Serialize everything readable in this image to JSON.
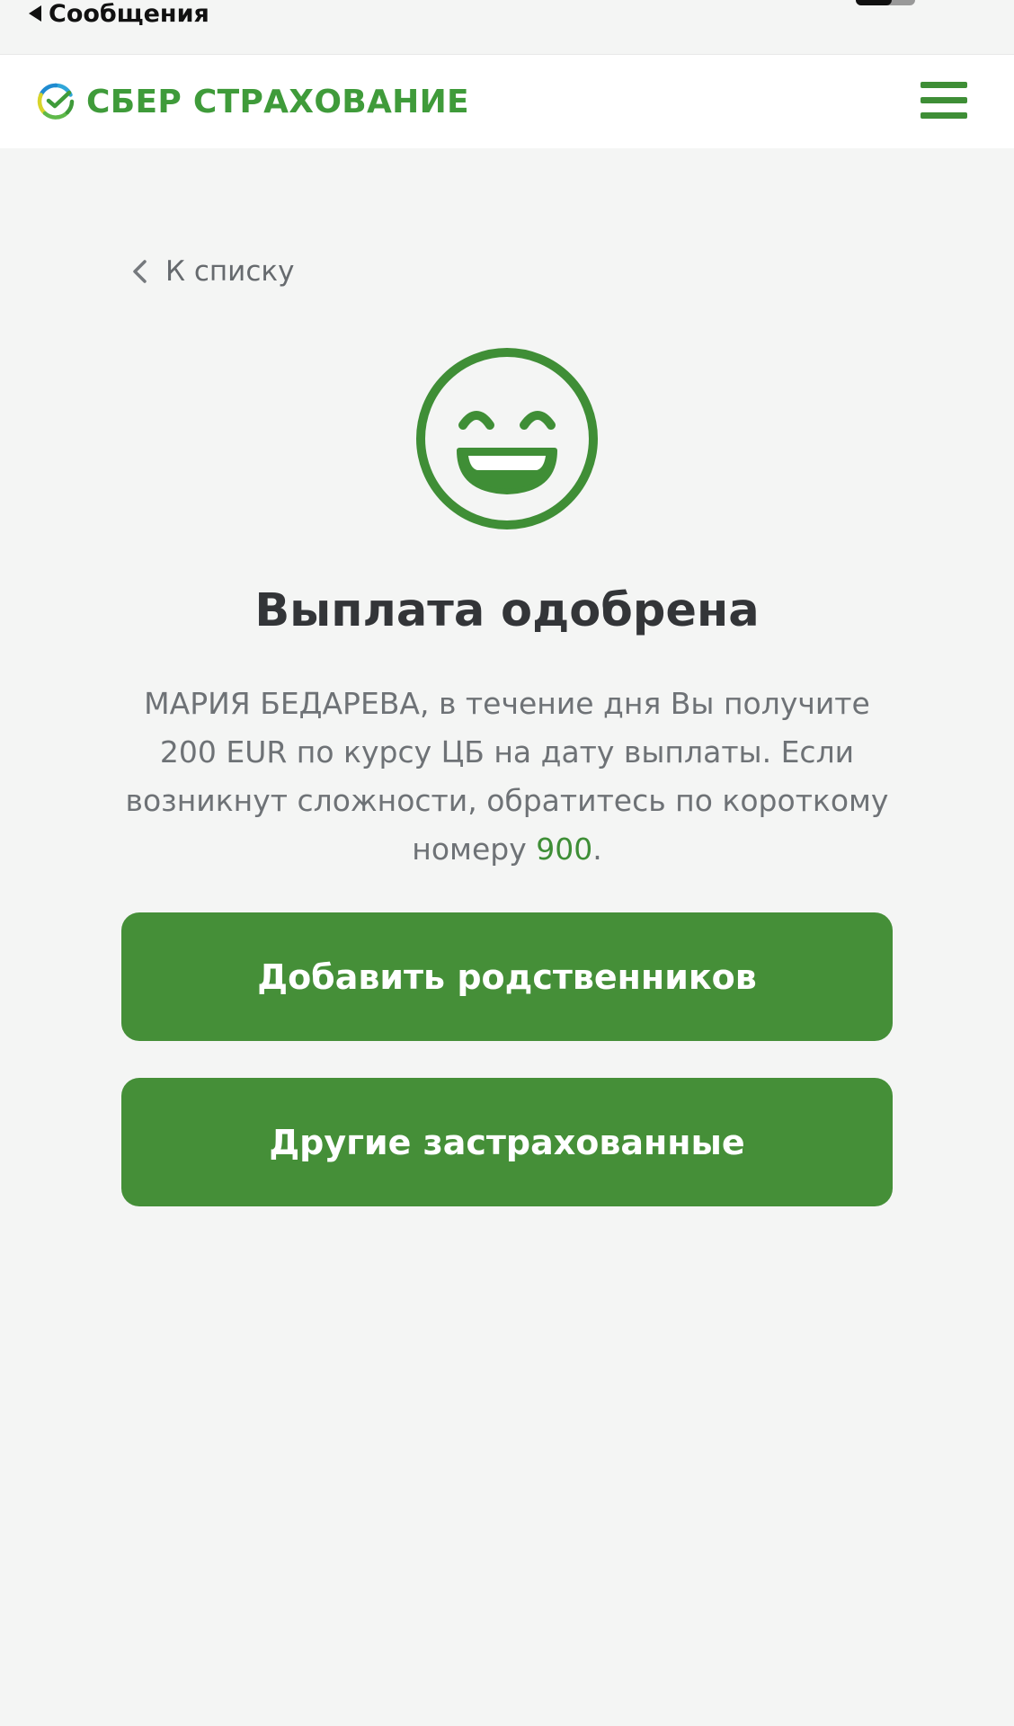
{
  "statusbar": {
    "back_label": "Сообщения"
  },
  "header": {
    "brand": "СБЕР СТРАХОВАНИЕ",
    "brand_color": "#3f9b3a",
    "menu_icon": "hamburger-menu-icon"
  },
  "nav": {
    "back_label": "К списку",
    "back_icon": "chevron-left-icon"
  },
  "status_icon": "smiling-face-icon",
  "title": "Выплата одобрена",
  "message": {
    "line1": "МАРИЯ БЕДАРЕВА, в течение дня Вы получите",
    "line2": "200 EUR по курсу ЦБ на дату выплаты. Если",
    "line3": "возникнут сложности, обратитесь по короткому",
    "line4_prefix": "номеру ",
    "phone": "900",
    "line4_suffix": "."
  },
  "actions": {
    "add_relatives": "Добавить родственников",
    "other_insured": "Другие застрахованные"
  },
  "colors": {
    "accent": "#458f38",
    "background": "#f4f5f4",
    "text_muted": "#6e7276",
    "title": "#333538"
  }
}
